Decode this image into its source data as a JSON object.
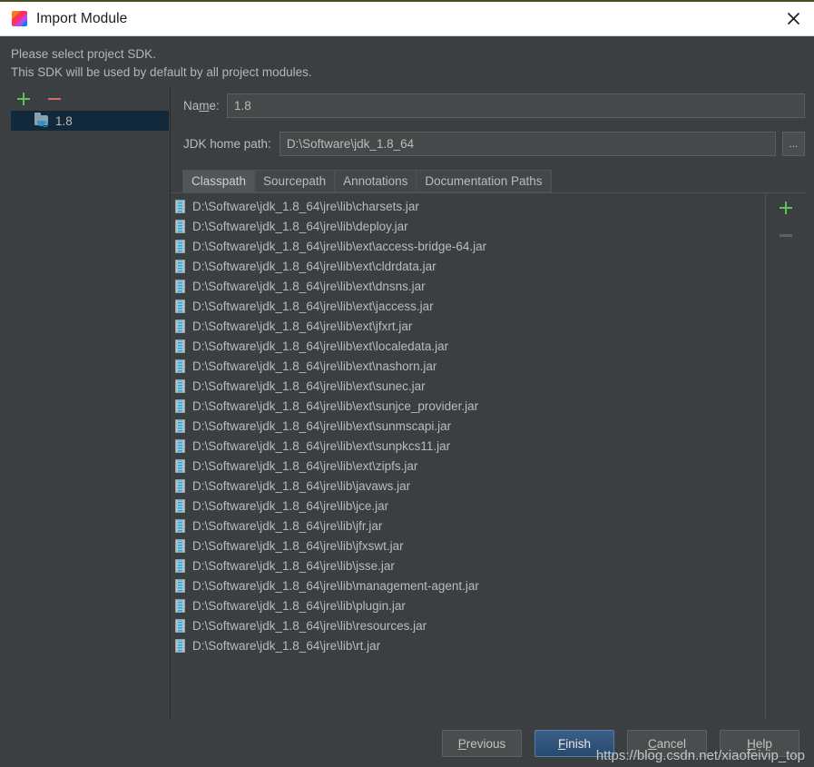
{
  "window": {
    "title": "Import Module",
    "app_icon": "intellij-idea-icon",
    "close_icon": "close-icon"
  },
  "description": {
    "line1": "Please select project SDK.",
    "line2": "This SDK will be used by default by all project modules."
  },
  "sidebar": {
    "toolbar": {
      "add_label": "+",
      "remove_label": "−"
    },
    "sdks": [
      {
        "label": "1.8",
        "icon": "jdk-folder-icon",
        "selected": true
      }
    ]
  },
  "fields": {
    "name": {
      "label_pre": "Na",
      "label_mnemonic": "m",
      "label_post": "e:",
      "value": "1.8"
    },
    "jdk_home_path": {
      "label": "JDK home path:",
      "value": "D:\\Software\\jdk_1.8_64",
      "browse_label": "..."
    }
  },
  "tabs": [
    {
      "label": "Classpath",
      "active": true
    },
    {
      "label": "Sourcepath",
      "active": false
    },
    {
      "label": "Annotations",
      "active": false
    },
    {
      "label": "Documentation Paths",
      "active": false
    }
  ],
  "classpath": {
    "add_label": "+",
    "remove_label": "−",
    "entries": [
      "D:\\Software\\jdk_1.8_64\\jre\\lib\\charsets.jar",
      "D:\\Software\\jdk_1.8_64\\jre\\lib\\deploy.jar",
      "D:\\Software\\jdk_1.8_64\\jre\\lib\\ext\\access-bridge-64.jar",
      "D:\\Software\\jdk_1.8_64\\jre\\lib\\ext\\cldrdata.jar",
      "D:\\Software\\jdk_1.8_64\\jre\\lib\\ext\\dnsns.jar",
      "D:\\Software\\jdk_1.8_64\\jre\\lib\\ext\\jaccess.jar",
      "D:\\Software\\jdk_1.8_64\\jre\\lib\\ext\\jfxrt.jar",
      "D:\\Software\\jdk_1.8_64\\jre\\lib\\ext\\localedata.jar",
      "D:\\Software\\jdk_1.8_64\\jre\\lib\\ext\\nashorn.jar",
      "D:\\Software\\jdk_1.8_64\\jre\\lib\\ext\\sunec.jar",
      "D:\\Software\\jdk_1.8_64\\jre\\lib\\ext\\sunjce_provider.jar",
      "D:\\Software\\jdk_1.8_64\\jre\\lib\\ext\\sunmscapi.jar",
      "D:\\Software\\jdk_1.8_64\\jre\\lib\\ext\\sunpkcs11.jar",
      "D:\\Software\\jdk_1.8_64\\jre\\lib\\ext\\zipfs.jar",
      "D:\\Software\\jdk_1.8_64\\jre\\lib\\javaws.jar",
      "D:\\Software\\jdk_1.8_64\\jre\\lib\\jce.jar",
      "D:\\Software\\jdk_1.8_64\\jre\\lib\\jfr.jar",
      "D:\\Software\\jdk_1.8_64\\jre\\lib\\jfxswt.jar",
      "D:\\Software\\jdk_1.8_64\\jre\\lib\\jsse.jar",
      "D:\\Software\\jdk_1.8_64\\jre\\lib\\management-agent.jar",
      "D:\\Software\\jdk_1.8_64\\jre\\lib\\plugin.jar",
      "D:\\Software\\jdk_1.8_64\\jre\\lib\\resources.jar",
      "D:\\Software\\jdk_1.8_64\\jre\\lib\\rt.jar"
    ]
  },
  "footer": {
    "buttons": [
      {
        "label": "Previous",
        "mnemonic": "P",
        "default": false
      },
      {
        "label": "Finish",
        "mnemonic": "F",
        "default": true
      },
      {
        "label": "Cancel",
        "mnemonic": "C",
        "default": false
      },
      {
        "label": "Help",
        "mnemonic": "H",
        "default": false
      }
    ],
    "watermark": "https://blog.csdn.net/xiaofeivip_top"
  },
  "colors": {
    "dialog_bg": "#3c3f41",
    "titlebar_bg": "#ffffff",
    "text": "#bbbbbb",
    "selection_bg": "#12293c",
    "accent_add": "#5ac35a",
    "accent_remove": "#d96b62",
    "default_button": "#2d5380"
  }
}
